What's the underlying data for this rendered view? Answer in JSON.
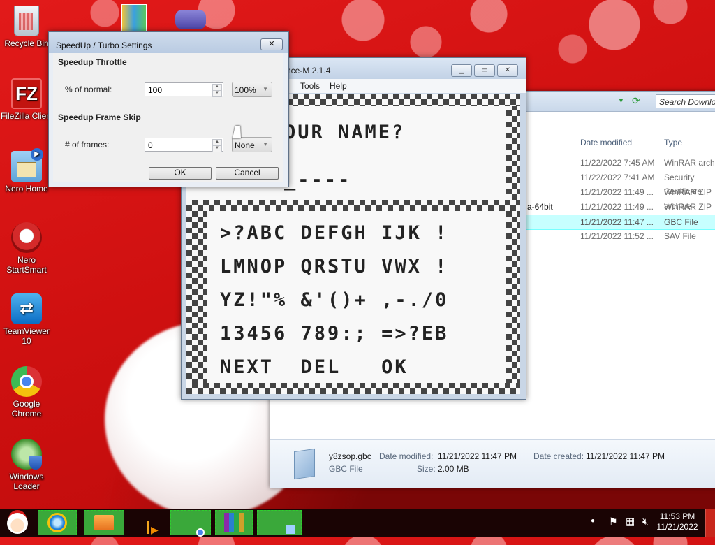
{
  "desktop": {
    "icons": [
      {
        "label": "Recycle Bin"
      },
      {
        "label": "FileZilla Client"
      },
      {
        "label": "Nero Home"
      },
      {
        "label": "Nero StartSmart"
      },
      {
        "label": "TeamViewer 10"
      },
      {
        "label": "Google Chrome"
      },
      {
        "label": "Windows Loader"
      }
    ]
  },
  "explorer": {
    "search_placeholder": "Search Downloads",
    "columns": {
      "date": "Date modified",
      "type": "Type"
    },
    "rows": [
      {
        "name": "",
        "date": "11/22/2022 7:45 AM",
        "type": "WinRAR archive",
        "selected": false
      },
      {
        "name": "",
        "date": "11/22/2022 7:41 AM",
        "type": "Security Certificate",
        "selected": false
      },
      {
        "name": "",
        "date": "11/21/2022 11:49 ...",
        "type": "WinRAR ZIP archive",
        "selected": false
      },
      {
        "name": "a-64bit",
        "date": "11/21/2022 11:49 ...",
        "type": "WinRAR ZIP archive",
        "selected": false
      },
      {
        "name": "",
        "date": "11/21/2022 11:47 ...",
        "type": "GBC File",
        "selected": true
      },
      {
        "name": "",
        "date": "11/21/2022 11:52 ...",
        "type": "SAV File",
        "selected": false
      }
    ],
    "details": {
      "file_name": "y8zsop.gbc",
      "file_type": "GBC File",
      "date_modified_label": "Date modified:",
      "date_modified": "11/21/2022 11:47 PM",
      "date_created_label": "Date created:",
      "date_created": "11/21/2022 11:47 PM",
      "size_label": "Size:",
      "size": "2.00 MB"
    }
  },
  "emulator": {
    "title": "nce-M 2.1.4",
    "menu": [
      "Tools",
      "Help"
    ],
    "screen": {
      "prompt": "OUR NAME?",
      "name_entry": "_----",
      "rows": [
        ">?ABC DEFGH IJK !",
        "LMNOP QRSTU VWX !",
        "YZ!\"% &'()+ ,-./0",
        "13456 789:; =>?EB",
        "NEXT  DEL   OK"
      ]
    }
  },
  "dialog": {
    "title": "SpeedUp / Turbo Settings",
    "close_label": "✕",
    "throttle": {
      "heading": "Speedup Throttle",
      "label": "% of normal:",
      "value": "100",
      "combo": "100%"
    },
    "frameskip": {
      "heading": "Speedup Frame Skip",
      "label": "# of frames:",
      "value": "0",
      "combo": "None"
    },
    "ok_label": "OK",
    "cancel_label": "Cancel"
  },
  "taskbar": {
    "apps": [
      "internet-explorer",
      "file-explorer",
      "media-player",
      "google-chrome",
      "winrar",
      "gba-emulator"
    ],
    "time": "11:53 PM",
    "date": "11/21/2022"
  },
  "colors": {
    "wallpaper": "#d31212",
    "selection": "#c7ffff",
    "taskbar": "#1a0404",
    "taskbar_highlight": "#3aa83a"
  }
}
